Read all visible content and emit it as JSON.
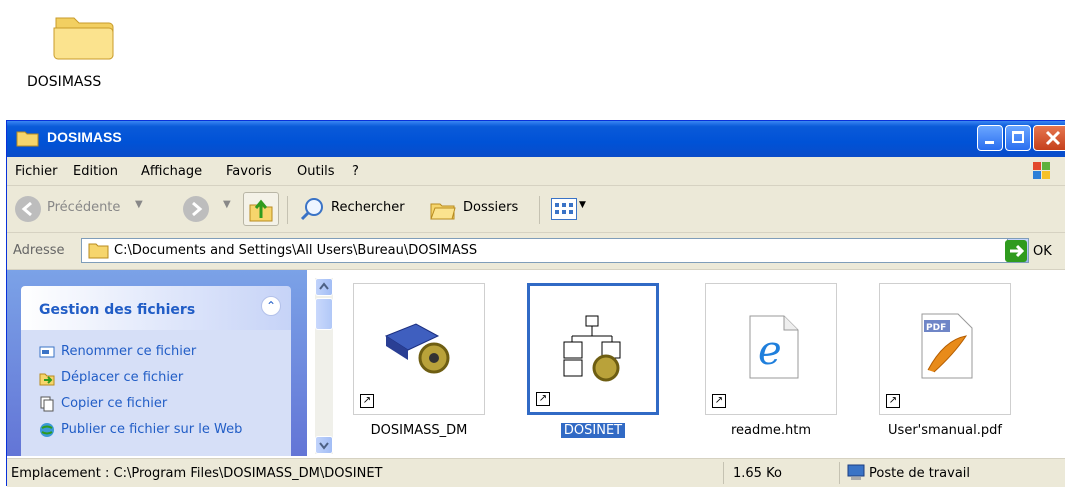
{
  "desktop": {
    "icon_label": "DOSIMASS"
  },
  "window": {
    "title": "DOSIMASS"
  },
  "menu": [
    "Fichier",
    "Edition",
    "Affichage",
    "Favoris",
    "Outils",
    "?"
  ],
  "toolbar": {
    "back_label": "Précédente",
    "search_label": "Rechercher",
    "folders_label": "Dossiers"
  },
  "address": {
    "label": "Adresse",
    "value": "C:\\Documents and Settings\\All Users\\Bureau\\DOSIMASS",
    "go_label": "OK"
  },
  "taskpane": {
    "title": "Gestion des fichiers",
    "links": [
      "Renommer ce fichier",
      "Déplacer ce fichier",
      "Copier ce fichier",
      "Publier ce fichier sur le Web"
    ]
  },
  "files": [
    {
      "name": "DOSIMASS_DM",
      "icon": "dosimass-dm-icon",
      "selected": false
    },
    {
      "name": "DOSINET",
      "icon": "dosinet-icon",
      "selected": true
    },
    {
      "name": "readme.htm",
      "icon": "internet-explorer-icon",
      "selected": false
    },
    {
      "name": "User'smanual.pdf",
      "icon": "pdf-icon",
      "selected": false
    }
  ],
  "status": {
    "location": "Emplacement : C:\\Program Files\\DOSIMASS_DM\\DOSINET",
    "size": "1.65 Ko",
    "zone": "Poste de travail"
  }
}
